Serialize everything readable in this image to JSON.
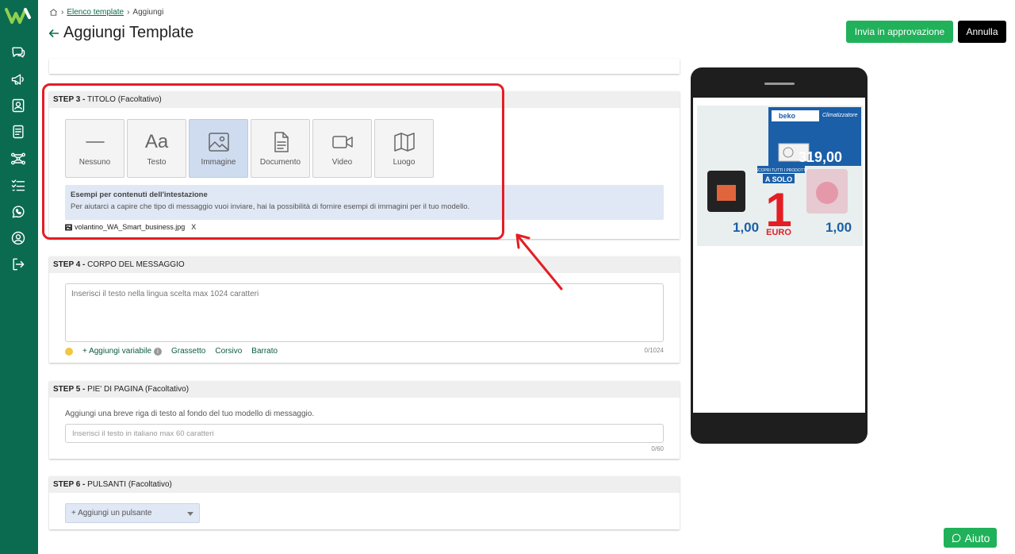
{
  "breadcrumb": {
    "home": "home-icon",
    "template_list": "Elenco template",
    "current": "Aggiungi"
  },
  "page": {
    "title": "Aggiungi Template"
  },
  "header_actions": {
    "approve": "Invia in approvazione",
    "cancel": "Annulla"
  },
  "colors": {
    "brand": "#0b6b50",
    "accent": "#20b15a",
    "highlight": "#e31e24"
  },
  "sidebar": {
    "items": [
      {
        "icon": "chat-icon"
      },
      {
        "icon": "megaphone-icon"
      },
      {
        "icon": "contacts-icon"
      },
      {
        "icon": "document-icon"
      },
      {
        "icon": "flow-icon"
      },
      {
        "icon": "checklist-icon"
      },
      {
        "icon": "whatsapp-icon"
      },
      {
        "icon": "user-icon"
      },
      {
        "icon": "logout-icon"
      }
    ]
  },
  "step3": {
    "step": "STEP 3 -",
    "title": "TITOLO (Facoltativo)",
    "options": [
      {
        "label": "Nessuno",
        "icon": "dash-icon",
        "selected": false
      },
      {
        "label": "Testo",
        "icon": "text-icon",
        "glyph": "Aa",
        "selected": false
      },
      {
        "label": "Immagine",
        "icon": "image-icon",
        "selected": true
      },
      {
        "label": "Documento",
        "icon": "document-icon",
        "selected": false
      },
      {
        "label": "Video",
        "icon": "video-icon",
        "selected": false
      },
      {
        "label": "Luogo",
        "icon": "map-icon",
        "selected": false
      }
    ],
    "info_title": "Esempi per contenuti dell'intestazione",
    "info_text": "Per aiutarci a capire che tipo di messaggio vuoi inviare, hai la possibilità di fornire esempi di immagini per il tuo modello.",
    "file_name": "volantino_WA_Smart_business.jpg",
    "file_remove": "X"
  },
  "step4": {
    "step": "STEP 4 -",
    "title": "CORPO DEL MESSAGGIO",
    "placeholder": "Inserisci il testo nella lingua scelta max 1024 caratteri",
    "add_variable": "+ Aggiungi variabile",
    "bold": "Grassetto",
    "italic": "Corsivo",
    "strike": "Barrato",
    "counter": "0/1024"
  },
  "step5": {
    "step": "STEP 5 -",
    "title": "PIE' DI PAGINA (Facoltativo)",
    "helper": "Aggiungi una breve riga di testo al fondo del tuo modello di messaggio.",
    "placeholder": "Inserisci il testo in italiano max 60 caratteri",
    "counter": "0/60"
  },
  "step6": {
    "step": "STEP 6 -",
    "title": "PULSANTI (Facoltativo)",
    "select": "+ Aggiungi un pulsante"
  },
  "flyer": {
    "brand": "beko",
    "product_title": "Climatizzatore",
    "price_main": "319,00",
    "promo": "SCOPRI TUTTI I PRODOTTI",
    "a_solo": "A SOLO",
    "one": "1",
    "euro": "EURO",
    "left_price": "1,00",
    "right_price": "1,00"
  },
  "help": {
    "label": "Aiuto"
  }
}
